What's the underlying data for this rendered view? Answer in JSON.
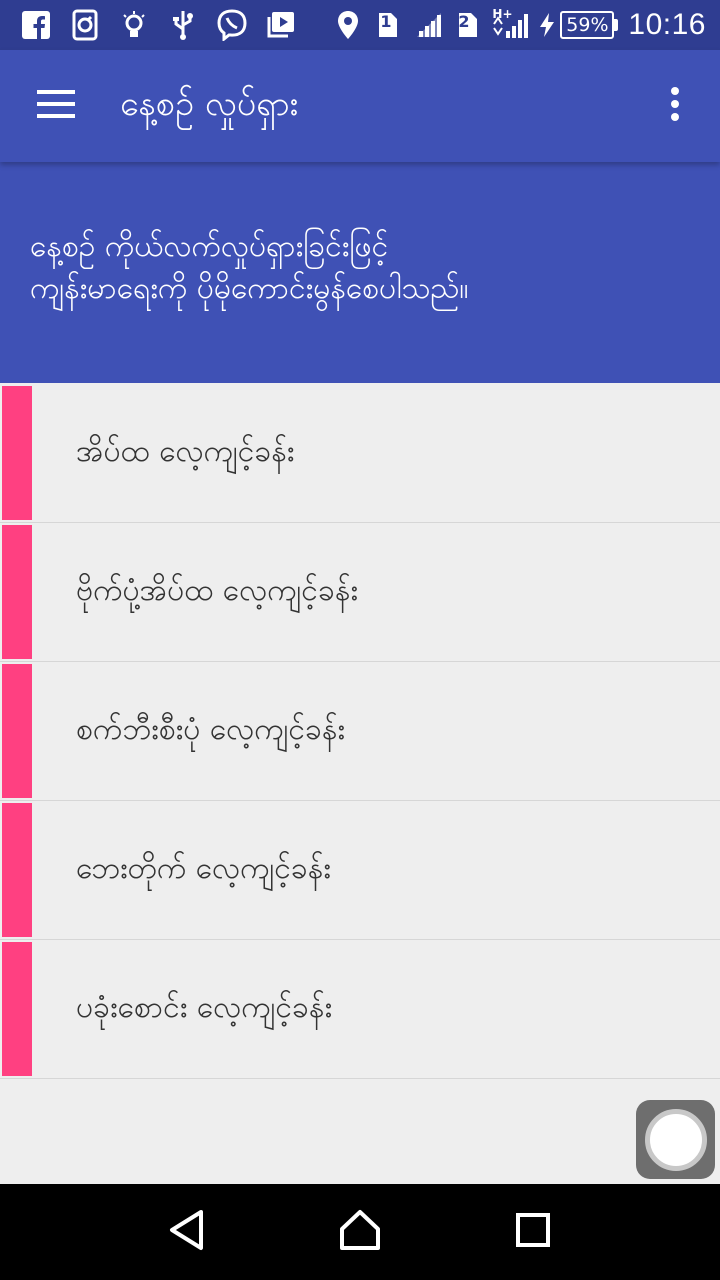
{
  "status_bar": {
    "left_icons": [
      "facebook-icon",
      "browser-icon",
      "lightbulb-icon",
      "usb-icon",
      "viber-icon",
      "video-library-icon"
    ],
    "sim1_label": "1",
    "sim2_label": "2",
    "network_type": "H+",
    "battery_percent": "59%",
    "time": "10:16"
  },
  "app_bar": {
    "title": "နေ့စဉ် လှုပ်ရှား",
    "menu_icon": "hamburger-menu-icon",
    "overflow_icon": "more-vert-icon"
  },
  "banner": {
    "line1": "နေ့စဉ် ကိုယ်လက်လှုပ်ရှားခြင်းဖြင့်",
    "line2": "ကျန်းမာရေးကို ပိုမိုကောင်းမွန်စေပါသည်။"
  },
  "list": {
    "items": [
      {
        "label": "အိပ်ထ လေ့ကျင့်ခန်း"
      },
      {
        "label": "ဗိုက်ပုံ့အိပ်ထ လေ့ကျင့်ခန်း"
      },
      {
        "label": "စက်ဘီးစီးပုံ လေ့ကျင့်ခန်း"
      },
      {
        "label": "ဘေးတိုက် လေ့ကျင့်ခန်း"
      },
      {
        "label": "ပခုံးစောင်း လေ့ကျင့်ခန်း"
      }
    ]
  },
  "nav_bar": {
    "back_icon": "back-icon",
    "home_icon": "home-icon",
    "recents_icon": "recents-icon"
  },
  "colors": {
    "status_bar": "#2f3d91",
    "primary": "#3f51b5",
    "accent": "#ff4081",
    "background": "#eeeeee"
  }
}
